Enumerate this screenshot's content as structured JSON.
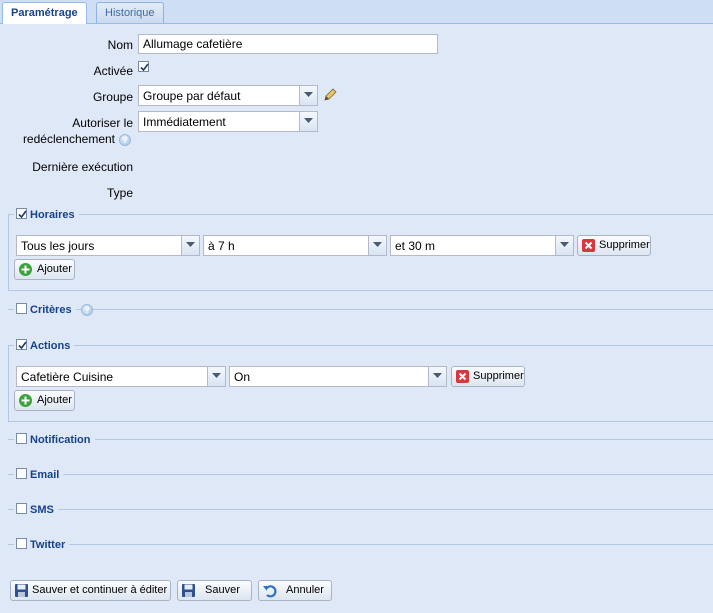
{
  "tabs": [
    {
      "label": "Paramétrage"
    },
    {
      "label": "Historique"
    }
  ],
  "form": {
    "nom_label": "Nom",
    "nom_value": "Allumage cafetière",
    "activee_label": "Activée",
    "activee_checked": true,
    "groupe_label": "Groupe",
    "groupe_value": "Groupe par défaut",
    "autoriser_label_1": "Autoriser le",
    "autoriser_label_2": "redéclenchement",
    "autoriser_value": "Immédiatement",
    "derniere_label": "Dernière exécution",
    "type_label": "Type"
  },
  "horaires": {
    "legend": "Horaires",
    "checked": true,
    "jours": "Tous les jours",
    "heure": "à 7 h",
    "minute": "et 30 m",
    "supprimer": "Supprimer",
    "ajouter": "Ajouter"
  },
  "criteres": {
    "legend": "Critères",
    "checked": false
  },
  "actions": {
    "legend": "Actions",
    "checked": true,
    "device": "Cafetière Cuisine",
    "state": "On",
    "supprimer": "Supprimer",
    "ajouter": "Ajouter"
  },
  "notification": {
    "legend": "Notification",
    "checked": false
  },
  "email": {
    "legend": "Email",
    "checked": false
  },
  "sms": {
    "legend": "SMS",
    "checked": false
  },
  "twitter": {
    "legend": "Twitter",
    "checked": false
  },
  "footer": {
    "save_continue": "Sauver et continuer à éditer",
    "save": "Sauver",
    "cancel": "Annuler"
  },
  "colors": {
    "panel_bg": "#dfe8f6",
    "title_blue": "#15428b",
    "delete_red": "#d9363e",
    "add_green": "#3aa33a"
  }
}
